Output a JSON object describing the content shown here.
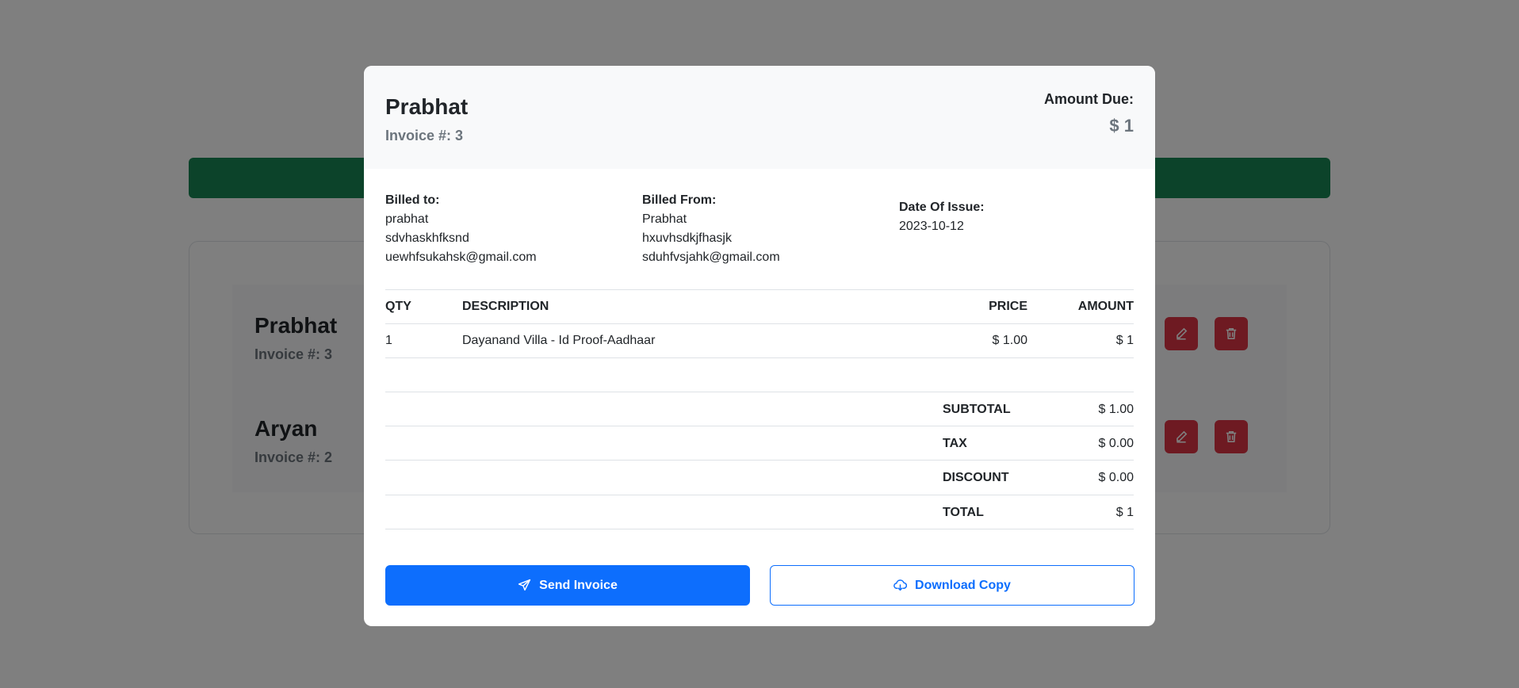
{
  "background": {
    "rows": [
      {
        "name": "Prabhat",
        "invoice": "Invoice #: 3"
      },
      {
        "name": "Aryan",
        "invoice": "Invoice #: 2"
      }
    ]
  },
  "modal": {
    "header": {
      "name": "Prabhat",
      "invoice": "Invoice #: 3",
      "amount_due_label": "Amount Due:",
      "amount_due_value": "$ 1"
    },
    "billed_to": {
      "label": "Billed to:",
      "name": "prabhat",
      "address": "sdvhaskhfksnd",
      "email": "uewhfsukahsk@gmail.com"
    },
    "billed_from": {
      "label": "Billed From:",
      "name": "Prabhat",
      "address": "hxuvhsdkjfhasjk",
      "email": "sduhfvsjahk@gmail.com"
    },
    "date_of_issue": {
      "label": "Date Of Issue:",
      "value": "2023-10-12"
    },
    "table": {
      "headers": {
        "qty": "QTY",
        "description": "DESCRIPTION",
        "price": "PRICE",
        "amount": "AMOUNT"
      },
      "items": [
        {
          "qty": "1",
          "description": "Dayanand Villa - Id Proof-Aadhaar",
          "price": "$ 1.00",
          "amount": "$ 1"
        }
      ]
    },
    "totals": {
      "subtotal_label": "SUBTOTAL",
      "subtotal": "$ 1.00",
      "tax_label": "TAX",
      "tax": "$ 0.00",
      "discount_label": "DISCOUNT",
      "discount": "$ 0.00",
      "total_label": "TOTAL",
      "total": "$ 1"
    },
    "buttons": {
      "send": "Send Invoice",
      "download": "Download Copy"
    }
  },
  "colors": {
    "primary": "#0d6efd",
    "success": "#198754",
    "danger": "#dc3545",
    "muted": "#6c757d"
  }
}
